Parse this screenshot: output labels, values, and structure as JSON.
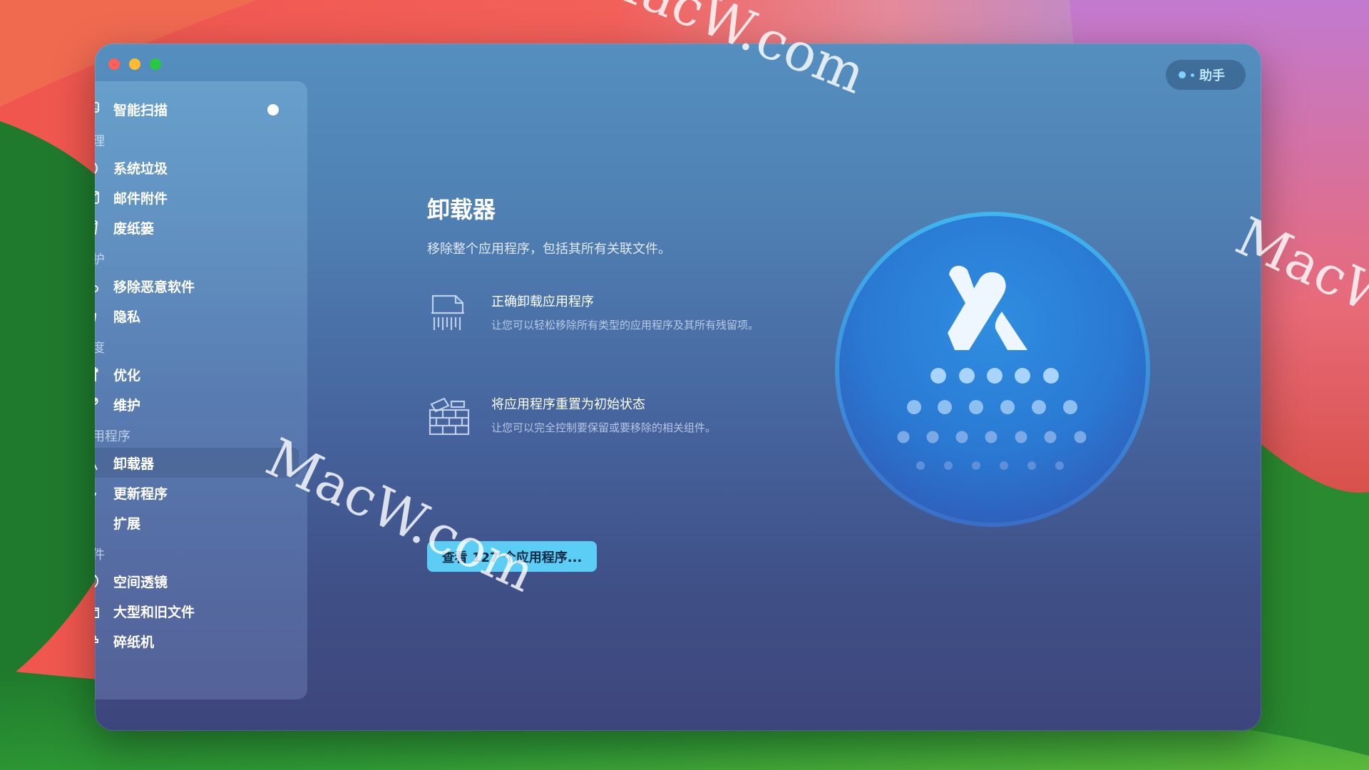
{
  "window": {
    "traffic_lights": [
      "close",
      "minimize",
      "maximize"
    ],
    "assistant_label": "助手"
  },
  "sidebar": {
    "smart_scan": {
      "label": "智能扫描",
      "icon": "display-icon"
    },
    "sections": [
      {
        "title": "清理",
        "items": [
          {
            "label": "系统垃圾",
            "icon": "trash-bin-icon"
          },
          {
            "label": "邮件附件",
            "icon": "mail-icon"
          },
          {
            "label": "废纸篓",
            "icon": "bucket-icon"
          }
        ]
      },
      {
        "title": "保护",
        "items": [
          {
            "label": "移除恶意软件",
            "icon": "biohazard-icon"
          },
          {
            "label": "隐私",
            "icon": "hand-icon"
          }
        ]
      },
      {
        "title": "速度",
        "items": [
          {
            "label": "优化",
            "icon": "sliders-icon"
          },
          {
            "label": "维护",
            "icon": "wrench-icon"
          }
        ]
      },
      {
        "title": "应用程序",
        "items": [
          {
            "label": "卸载器",
            "icon": "uninstaller-icon",
            "selected": true
          },
          {
            "label": "更新程序",
            "icon": "update-icon"
          },
          {
            "label": "扩展",
            "icon": "puzzle-icon"
          }
        ]
      },
      {
        "title": "文件",
        "items": [
          {
            "label": "空间透镜",
            "icon": "lens-icon"
          },
          {
            "label": "大型和旧文件",
            "icon": "folder-icon"
          },
          {
            "label": "碎纸机",
            "icon": "shredder-icon"
          }
        ]
      }
    ]
  },
  "main": {
    "title": "卸载器",
    "subtitle": "移除整个应用程序，包括其所有关联文件。",
    "features": [
      {
        "heading": "正确卸载应用程序",
        "desc": "让您可以轻松移除所有类型的应用程序及其所有残留项。",
        "icon": "shredded-document-icon"
      },
      {
        "heading": "将应用程序重置为初始状态",
        "desc": "让您可以完全控制要保留或要移除的相关组件。",
        "icon": "brick-wall-icon"
      }
    ],
    "cta_label": "查看 127 个应用程序..."
  },
  "watermark": "MacW.com",
  "colors": {
    "cta": "#5ccdf5",
    "hero_circle": "#2a7fd6",
    "close": "#fe5f57",
    "minimize": "#febc2e",
    "maximize": "#28c840"
  }
}
